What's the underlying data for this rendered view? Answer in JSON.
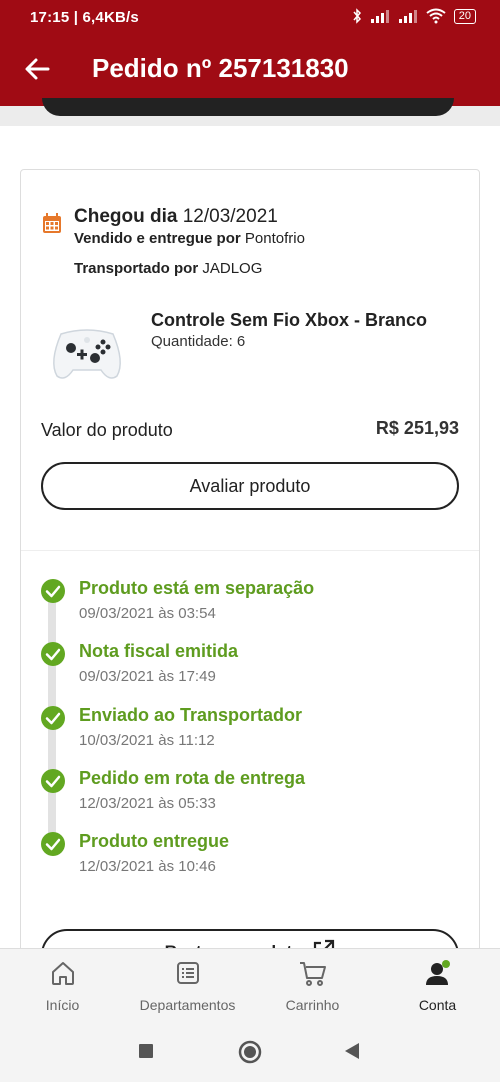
{
  "status_bar": {
    "time_speed": "17:15 | 6,4KB/s",
    "battery": "20"
  },
  "header": {
    "title": "Pedido nº 257131830"
  },
  "order": {
    "arrived_label": "Chegou dia",
    "arrived_date": "12/03/2021",
    "seller_label": "Vendido e entregue por",
    "seller": "Pontofrio",
    "carrier_label": "Transportado por",
    "carrier": "JADLOG"
  },
  "product": {
    "name": "Controle Sem Fio Xbox - Branco",
    "quantity": "Quantidade: 6"
  },
  "value": {
    "label": "Valor do produto",
    "amount": "R$ 251,93"
  },
  "buttons": {
    "rate": "Avaliar produto",
    "track": "Rastrear produto"
  },
  "timeline": [
    {
      "title": "Produto está em separação",
      "date": "09/03/2021 às 03:54"
    },
    {
      "title": "Nota fiscal emitida",
      "date": "09/03/2021 às 17:49"
    },
    {
      "title": "Enviado ao Transportador",
      "date": "10/03/2021 às 11:12"
    },
    {
      "title": "Pedido em rota de entrega",
      "date": "12/03/2021 às 05:33"
    },
    {
      "title": "Produto entregue",
      "date": "12/03/2021 às 10:46"
    }
  ],
  "bottom_nav": [
    {
      "label": "Início",
      "icon": "home-icon"
    },
    {
      "label": "Departamentos",
      "icon": "list-icon"
    },
    {
      "label": "Carrinho",
      "icon": "cart-icon"
    },
    {
      "label": "Conta",
      "icon": "account-icon"
    }
  ],
  "colors": {
    "brand": "#a00b14",
    "success": "#62a821",
    "calendar": "#e6782b"
  }
}
